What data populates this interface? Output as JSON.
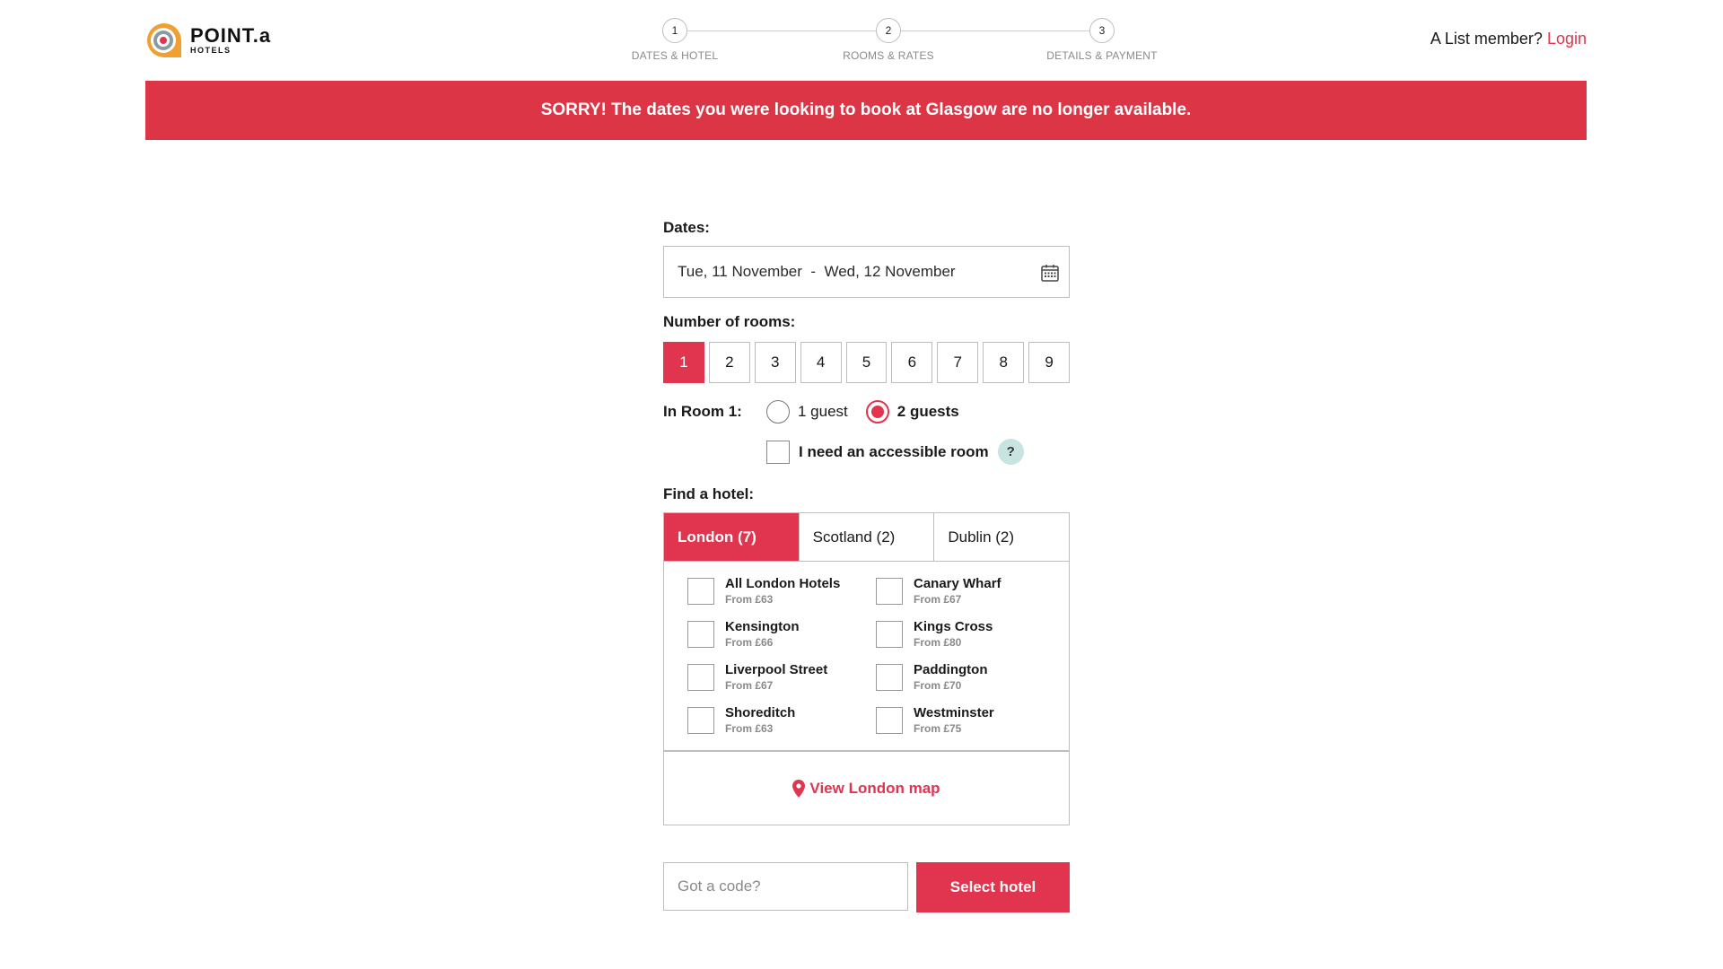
{
  "brand": {
    "name": "POINT.a",
    "sub": "HOTELS",
    "accent": "#e0344f",
    "logo_orange": "#f0a030"
  },
  "steps": [
    {
      "num": "1",
      "label": "DATES & HOTEL"
    },
    {
      "num": "2",
      "label": "ROOMS & RATES"
    },
    {
      "num": "3",
      "label": "DETAILS & PAYMENT"
    }
  ],
  "header": {
    "member_text": "A List member?",
    "login_label": "Login"
  },
  "alert": {
    "text": "SORRY! The dates you were looking to book at Glasgow are no longer available.",
    "color": "#dc3545"
  },
  "form": {
    "dates_label": "Dates:",
    "dates_value": "Tue, 11 November  -  Wed, 12 November",
    "rooms_label": "Number of rooms:",
    "rooms": [
      "1",
      "2",
      "3",
      "4",
      "5",
      "6",
      "7",
      "8",
      "9"
    ],
    "rooms_selected": "1",
    "room1_label": "In Room 1:",
    "guest_options": [
      {
        "label": "1 guest",
        "selected": false
      },
      {
        "label": "2 guests",
        "selected": true
      }
    ],
    "accessible_label": "I need an accessible room",
    "help_symbol": "?",
    "find_label": "Find a hotel:",
    "tabs": [
      {
        "label": "London (7)",
        "active": true
      },
      {
        "label": "Scotland (2)",
        "active": false
      },
      {
        "label": "Dublin (2)",
        "active": false
      }
    ],
    "hotels": [
      {
        "name": "All London Hotels",
        "price": "From £63"
      },
      {
        "name": "Canary Wharf",
        "price": "From £67"
      },
      {
        "name": "Kensington",
        "price": "From £66"
      },
      {
        "name": "Kings Cross",
        "price": "From £80"
      },
      {
        "name": "Liverpool Street",
        "price": "From £67"
      },
      {
        "name": "Paddington",
        "price": "From £70"
      },
      {
        "name": "Shoreditch",
        "price": "From £63"
      },
      {
        "name": "Westminster",
        "price": "From £75"
      }
    ],
    "map_link": "View London map",
    "code_placeholder": "Got a code?",
    "select_button": "Select hotel"
  }
}
